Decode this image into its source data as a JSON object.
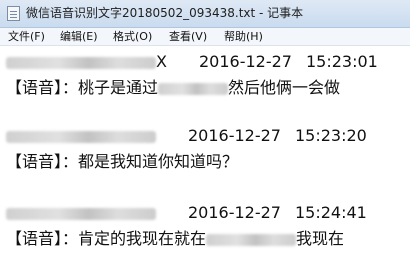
{
  "window": {
    "title": "微信语音识别文字20180502_093438.txt - 记事本"
  },
  "menu": [
    {
      "label": "文件(F)"
    },
    {
      "label": "编辑(E)"
    },
    {
      "label": "格式(O)"
    },
    {
      "label": "查看(V)"
    },
    {
      "label": "帮助(H)"
    }
  ],
  "entries": [
    {
      "name_tail": "X",
      "date": "2016-12-27",
      "time": "15:23:01",
      "tag": "【语音】",
      "text_before": "：桃子是通过",
      "text_after": "然后他俩一会做"
    },
    {
      "name_tail": "",
      "date": "2016-12-27",
      "time": "15:23:20",
      "tag": "【语音】",
      "text_before": "：都是我知道你知道吗？",
      "text_after": ""
    },
    {
      "name_tail": "",
      "date": "2016-12-27",
      "time": "15:24:41",
      "tag": "【语音】",
      "text_before": "：肯定的我现在就在",
      "text_after": "我现在"
    }
  ]
}
